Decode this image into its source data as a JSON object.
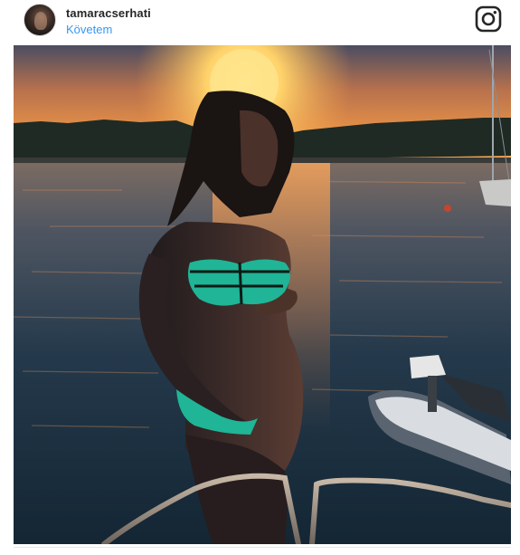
{
  "post": {
    "username": "tamaracserhati",
    "follow_label": "Követem",
    "avatar_icon": "profile-avatar",
    "brand_icon": "instagram-icon"
  },
  "colors": {
    "link": "#3897f0",
    "username": "#262626",
    "sky_top": "#4a4f66",
    "sky_horizon": "#f6a04b",
    "sun": "#ffd772",
    "water_deep": "#1b3345",
    "bikini": "#1fb596"
  }
}
